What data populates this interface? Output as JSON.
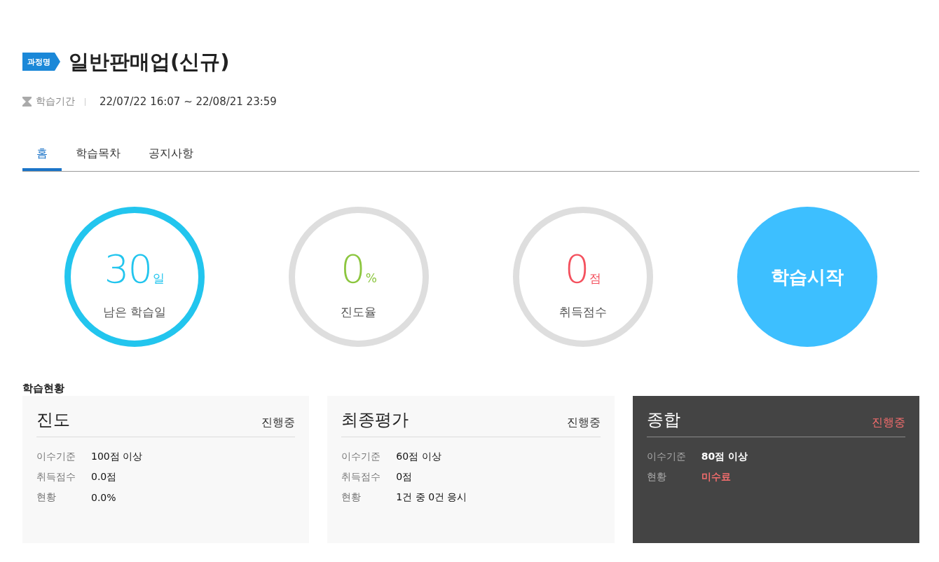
{
  "course": {
    "tag": "과정명",
    "title": "일반판매업(신규)"
  },
  "period": {
    "label": "학습기간",
    "value": "22/07/22 16:07 ~ 22/08/21 23:59"
  },
  "tabs": [
    {
      "label": "홈",
      "selected": true
    },
    {
      "label": "학습목차",
      "selected": false
    },
    {
      "label": "공지사항",
      "selected": false
    }
  ],
  "stats": [
    {
      "value": "30",
      "unit": "일",
      "label": "남은 학습일",
      "highlighted": true,
      "color": "#22c5ee"
    },
    {
      "value": "0",
      "unit": "%",
      "label": "진도율",
      "highlighted": false,
      "color": "#8cc63f"
    },
    {
      "value": "0",
      "unit": "점",
      "label": "취득점수",
      "highlighted": false,
      "color": "#f4515e"
    }
  ],
  "start_button": {
    "label": "학습시작"
  },
  "status_section": {
    "title": "학습현황",
    "cards": [
      {
        "kind": "detail",
        "title": "진도",
        "status": "진행중",
        "rows": [
          {
            "label": "이수기준",
            "value": "100점 이상",
            "alert": false
          },
          {
            "label": "취득점수",
            "value": "0.0점",
            "alert": false
          },
          {
            "label": "현황",
            "value": "0.0%",
            "alert": false
          }
        ]
      },
      {
        "kind": "detail",
        "title": "최종평가",
        "status": "진행중",
        "rows": [
          {
            "label": "이수기준",
            "value": "60점 이상",
            "alert": false
          },
          {
            "label": "취득점수",
            "value": "0점",
            "alert": false
          },
          {
            "label": "현황",
            "value": "1건 중 0건 응시",
            "alert": false
          }
        ]
      },
      {
        "kind": "summary",
        "title": "종합",
        "status": "진행중",
        "rows": [
          {
            "label": "이수기준",
            "value": "80점 이상",
            "alert": false
          },
          {
            "label": "현황",
            "value": "미수료",
            "alert": true
          }
        ]
      }
    ]
  }
}
